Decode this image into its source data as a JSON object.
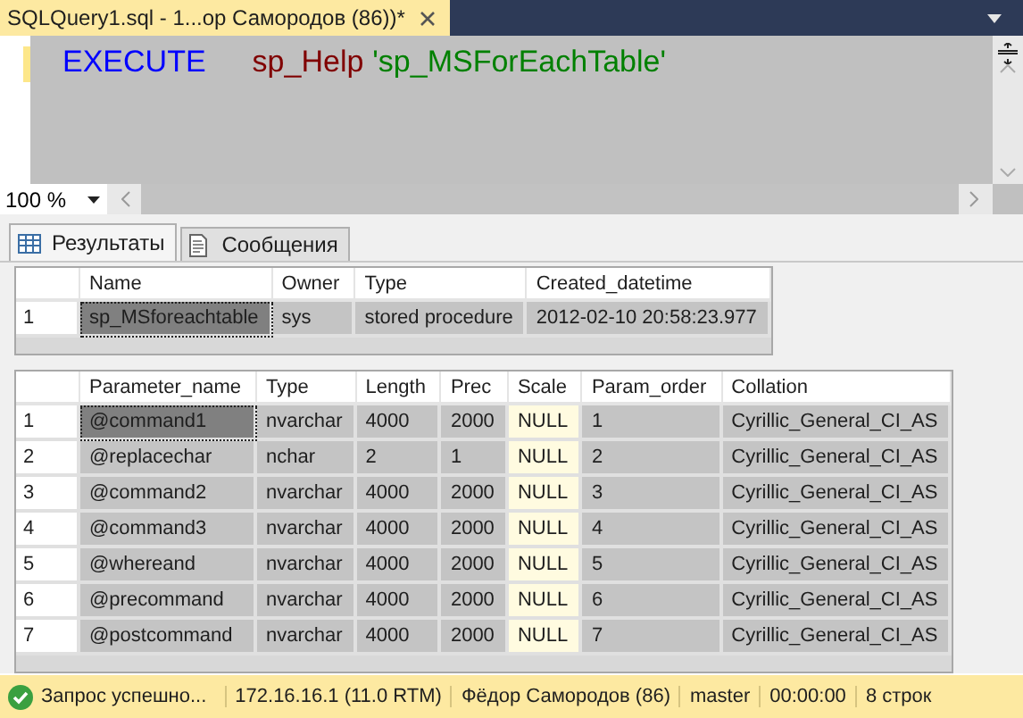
{
  "document_tab": {
    "title": "SQLQuery1.sql - 1...ор Самородов (86))*",
    "selected": true
  },
  "editor": {
    "modified": true,
    "tokens": [
      {
        "text": "EXECUTE",
        "kind": "keyword"
      },
      {
        "text": "sp_Help",
        "kind": "procedure"
      },
      {
        "text": "'sp_MSForEachTable'",
        "kind": "string"
      }
    ]
  },
  "zoom": {
    "value": "100 %"
  },
  "result_tabs": [
    {
      "label": "Результаты",
      "kind": "grid",
      "selected": true
    },
    {
      "label": "Сообщения",
      "kind": "messages",
      "selected": false
    }
  ],
  "grids": [
    {
      "columns": [
        {
          "label": "Name",
          "kind": "text"
        },
        {
          "label": "Owner",
          "kind": "text"
        },
        {
          "label": "Type",
          "kind": "text"
        },
        {
          "label": "Created_datetime",
          "kind": "text"
        }
      ],
      "rows": [
        {
          "number": "1",
          "focused": true,
          "cells": [
            "sp_MSforeachtable",
            "sys",
            "stored procedure",
            "2012-02-10 20:58:23.977"
          ]
        }
      ]
    },
    {
      "columns": [
        {
          "label": "Parameter_name",
          "kind": "text"
        },
        {
          "label": "Type",
          "kind": "text"
        },
        {
          "label": "Length",
          "kind": "text"
        },
        {
          "label": "Prec",
          "kind": "text"
        },
        {
          "label": "Scale",
          "kind": "null"
        },
        {
          "label": "Param_order",
          "kind": "text"
        },
        {
          "label": "Collation",
          "kind": "text"
        }
      ],
      "rows": [
        {
          "number": "1",
          "focused": true,
          "cells": [
            "@command1",
            "nvarchar",
            "4000",
            "2000",
            "NULL",
            "1",
            "Cyrillic_General_CI_AS"
          ]
        },
        {
          "number": "2",
          "focused": false,
          "cells": [
            "@replacechar",
            "nchar",
            "2",
            "1",
            "NULL",
            "2",
            "Cyrillic_General_CI_AS"
          ]
        },
        {
          "number": "3",
          "focused": false,
          "cells": [
            "@command2",
            "nvarchar",
            "4000",
            "2000",
            "NULL",
            "3",
            "Cyrillic_General_CI_AS"
          ]
        },
        {
          "number": "4",
          "focused": false,
          "cells": [
            "@command3",
            "nvarchar",
            "4000",
            "2000",
            "NULL",
            "4",
            "Cyrillic_General_CI_AS"
          ]
        },
        {
          "number": "5",
          "focused": false,
          "cells": [
            "@whereand",
            "nvarchar",
            "4000",
            "2000",
            "NULL",
            "5",
            "Cyrillic_General_CI_AS"
          ]
        },
        {
          "number": "6",
          "focused": false,
          "cells": [
            "@precommand",
            "nvarchar",
            "4000",
            "2000",
            "NULL",
            "6",
            "Cyrillic_General_CI_AS"
          ]
        },
        {
          "number": "7",
          "focused": false,
          "cells": [
            "@postcommand",
            "nvarchar",
            "4000",
            "2000",
            "NULL",
            "7",
            "Cyrillic_General_CI_AS"
          ]
        }
      ]
    }
  ],
  "status_bar": {
    "message": "Запрос успешно...",
    "server": "172.16.16.1 (11.0 RTM)",
    "user": "Фёдор Самородов (86)",
    "database": "master",
    "elapsed": "00:00:00",
    "rows": "8 строк"
  }
}
